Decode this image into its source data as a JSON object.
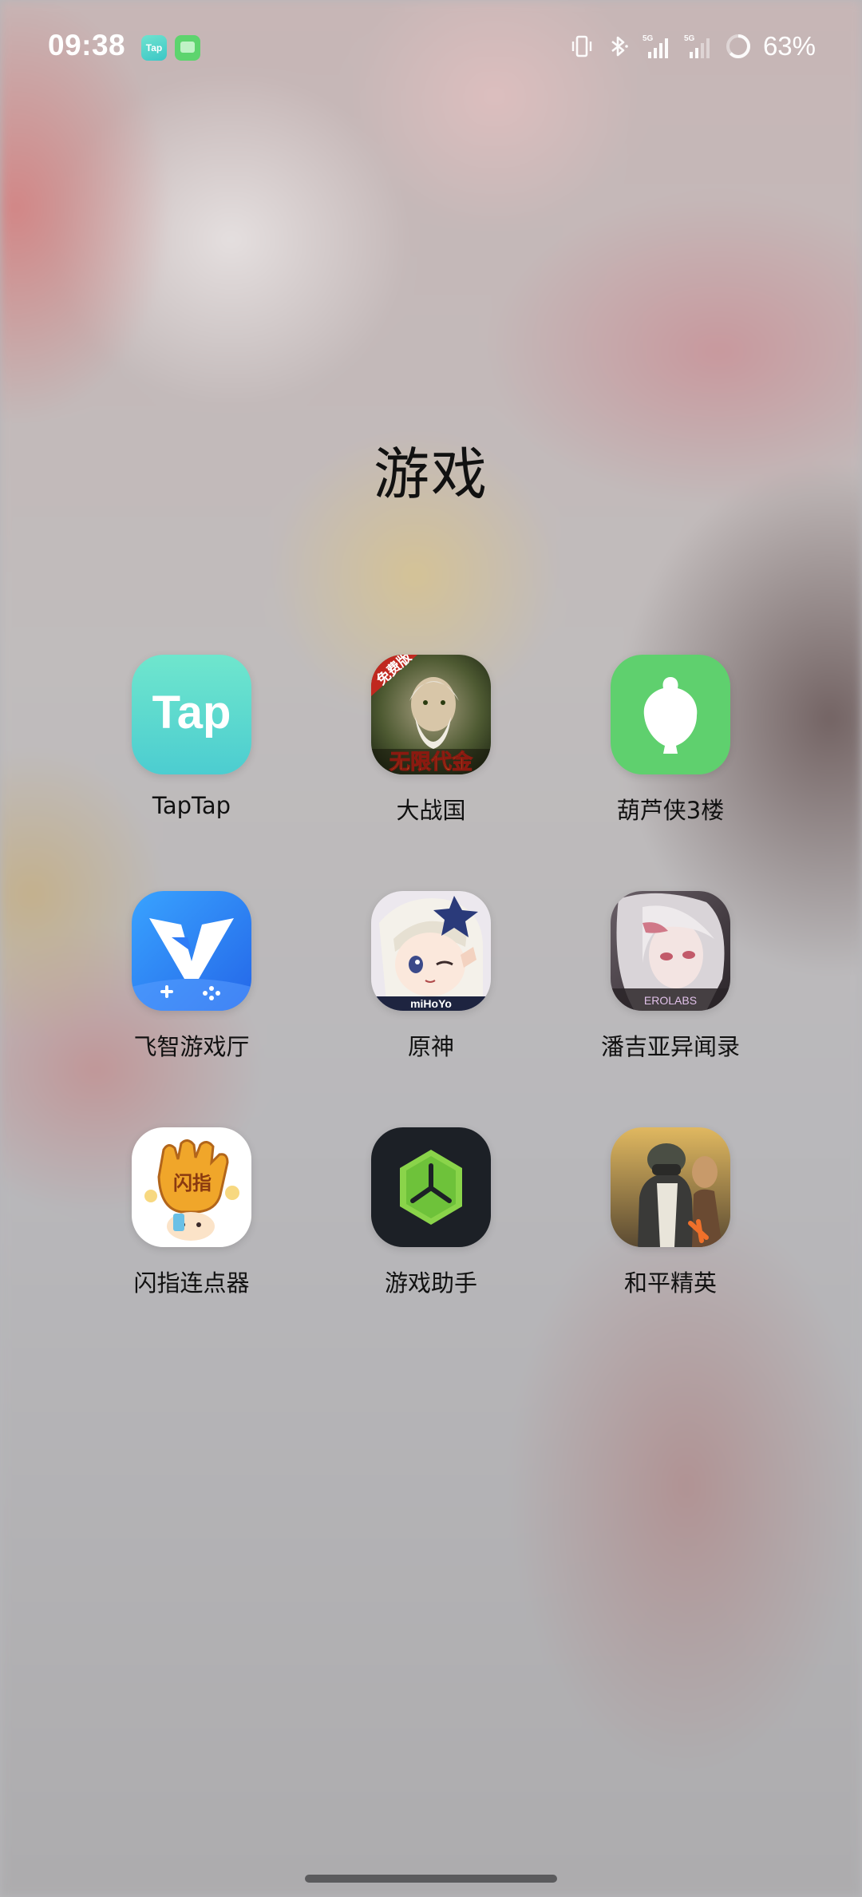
{
  "status_bar": {
    "time": "09:38",
    "notification_icons": [
      "taptap-notification-icon",
      "message-notification-icon"
    ],
    "notification_tap_text": "Tap",
    "status_icons": [
      "vibrate-icon",
      "bluetooth-icon",
      "signal-5g-icon",
      "signal-5g-icon",
      "battery-ring-icon"
    ],
    "signal_label": "5G",
    "battery_percent": "63%"
  },
  "folder": {
    "title": "游戏"
  },
  "apps": [
    {
      "label": "TapTap",
      "icon": "taptap-icon",
      "color": "#5fd9c9"
    },
    {
      "label": "大战国",
      "icon": "dazhanguo-icon",
      "color": "#2f3a22",
      "icon_text": "免费版",
      "icon_text2": "无限代金"
    },
    {
      "label": "葫芦侠3楼",
      "icon": "huluxia-icon",
      "color": "#5fd06e"
    },
    {
      "label": "飞智游戏厅",
      "icon": "flydigi-icon",
      "color": "#2f7cf6"
    },
    {
      "label": "原神",
      "icon": "genshin-icon",
      "color": "#e9e4ea",
      "icon_text": "miHoYo"
    },
    {
      "label": "潘吉亚异闻录",
      "icon": "pangea-icon",
      "color": "#3a3238",
      "icon_text": "EROLABS"
    },
    {
      "label": "闪指连点器",
      "icon": "shanzhi-icon",
      "color": "#ffffff",
      "icon_text": "闪指"
    },
    {
      "label": "游戏助手",
      "icon": "game-assistant-icon",
      "color": "#1c2026"
    },
    {
      "label": "和平精英",
      "icon": "peace-elite-icon",
      "color": "#7a6a4a"
    }
  ]
}
